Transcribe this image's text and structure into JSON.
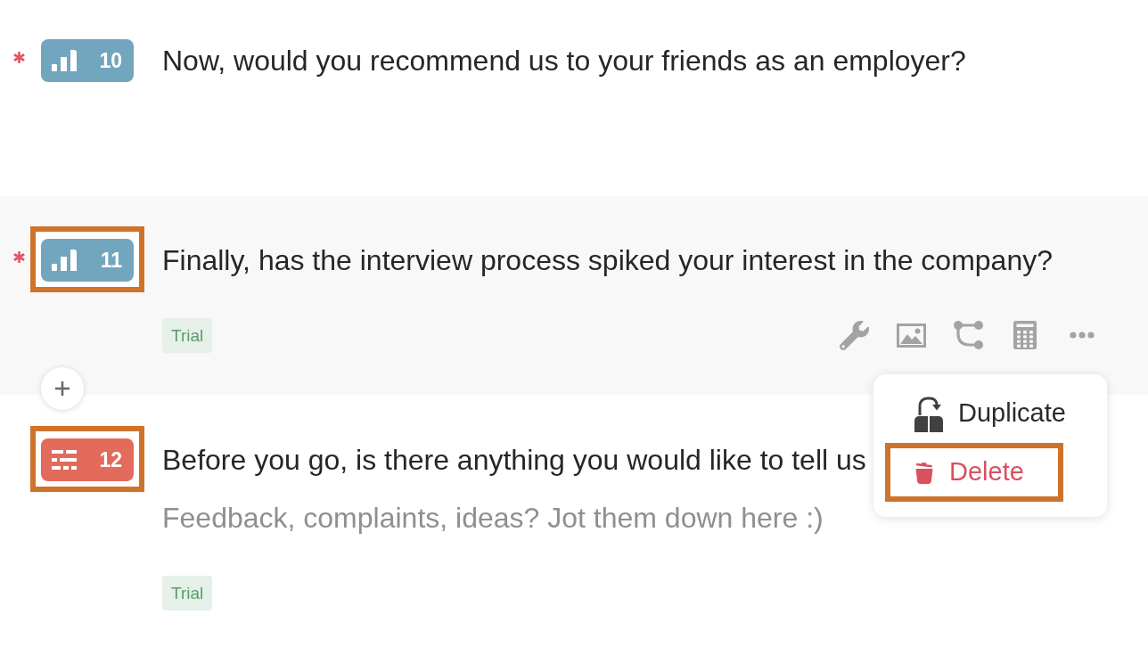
{
  "questions": [
    {
      "number": "10",
      "kind": "rating",
      "required": true,
      "selected": false,
      "highlighted": false,
      "text": "Now, would you recommend us to your friends as an employer?"
    },
    {
      "number": "11",
      "kind": "rating",
      "required": true,
      "selected": true,
      "highlighted": true,
      "text": "Finally, has the interview process spiked your interest in the company?",
      "tag": "Trial"
    },
    {
      "number": "12",
      "kind": "long_text",
      "required": false,
      "selected": false,
      "highlighted": true,
      "text": "Before you go, is there anything you would like to tell us",
      "description": "Feedback, complaints, ideas? Jot them down here :)",
      "tag": "Trial"
    }
  ],
  "menu": {
    "items": [
      {
        "label": "Duplicate",
        "kind": "duplicate",
        "highlighted": false
      },
      {
        "label": "Delete",
        "kind": "delete",
        "highlighted": true
      }
    ]
  }
}
